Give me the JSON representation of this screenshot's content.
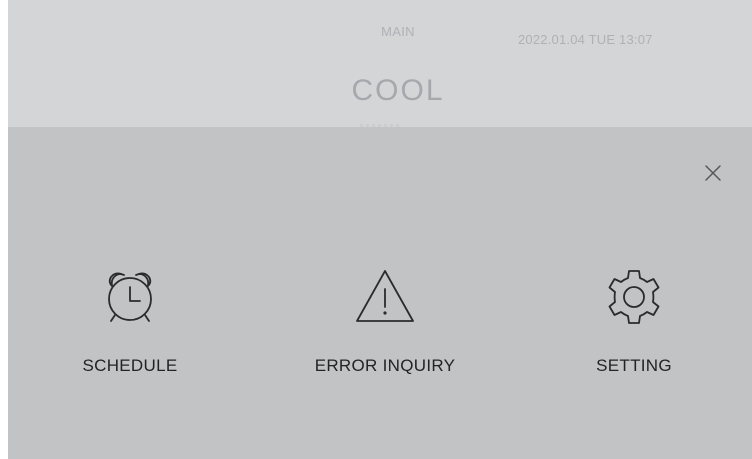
{
  "header": {
    "menu_label": "MAIN",
    "datetime": "2022.01.04 TUE 13:07",
    "mode": "COOL"
  },
  "overlay": {
    "close_icon": "close-icon",
    "items": [
      {
        "label": "SCHEDULE",
        "icon": "alarm-clock-icon"
      },
      {
        "label": "ERROR INQUIRY",
        "icon": "warning-triangle-icon"
      },
      {
        "label": "SETTING",
        "icon": "gear-icon"
      }
    ]
  },
  "colors": {
    "header_bg": "#d3d5d7",
    "overlay_bg": "#c1c3c5",
    "label_text": "#222325",
    "icon_stroke": "#2a2b2d"
  }
}
